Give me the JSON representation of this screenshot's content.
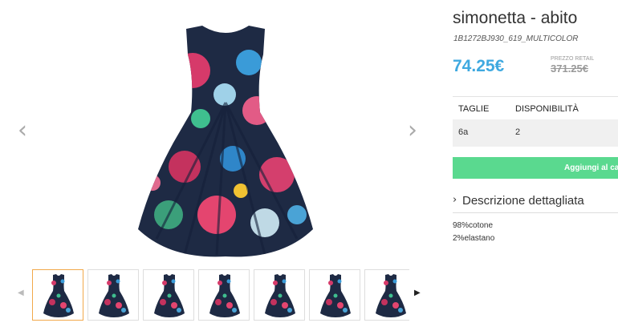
{
  "product": {
    "title": "simonetta - abito",
    "sku": "1B1272BJ930_619_MULTICOLOR",
    "price": "74.25€",
    "retail_label": "PREZZO RETAIL",
    "retail_price": "371.25€"
  },
  "sizes_table": {
    "headers": [
      "TAGLIE",
      "DISPONIBILITÀ"
    ],
    "rows": [
      [
        "6a",
        "2"
      ]
    ]
  },
  "add_to_cart_label": "Aggiungi al ca",
  "description": {
    "toggle_label": "Descrizione dettagliata",
    "lines": [
      "98%cotone",
      "2%elastano"
    ]
  },
  "gallery": {
    "prev_icon": "chevron-left-icon",
    "next_icon": "chevron-right-icon",
    "thumbnail_count": 7,
    "active_thumbnail": 1
  },
  "colors": {
    "price": "#3fa9e0",
    "add_button": "#5ad98f",
    "active_thumb_border": "#f2a94b"
  }
}
